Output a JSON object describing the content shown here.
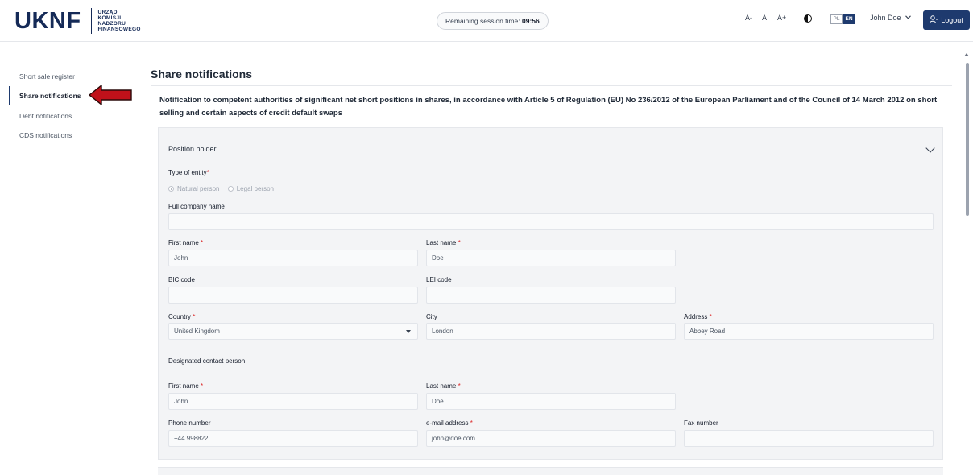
{
  "header": {
    "logo_main": "UKNF",
    "logo_sub": [
      "URZĄD",
      "KOMISJI",
      "NADZORU",
      "FINANSOWEGO"
    ],
    "session_label": "Remaining session time:",
    "session_time": "09:56",
    "font_decrease": "A-",
    "font_normal": "A",
    "font_increase": "A+",
    "lang_pl": "PL",
    "lang_en": "EN",
    "user_name": "John Doe",
    "logout_label": "Logout"
  },
  "sidebar": {
    "items": [
      {
        "label": "Short sale register",
        "active": false
      },
      {
        "label": "Share notifications",
        "active": true
      },
      {
        "label": "Debt notifications",
        "active": false
      },
      {
        "label": "CDS notifications",
        "active": false
      }
    ]
  },
  "main": {
    "title": "Share notifications",
    "description": "Notification to competent authorities of significant net short positions in shares, in accordance with Article 5 of Regulation (EU) No 236/2012 of the European Parliament and of the Council of 14 March 2012 on short selling and certain aspects of credit default swaps",
    "section_title": "Position holder",
    "entity_type_label": "Type of entity",
    "entity_options": [
      "Natural person",
      "Legal person"
    ],
    "full_company_name_label": "Full company name",
    "full_company_name_value": "",
    "first_name_label": "First name",
    "first_name_value": "John",
    "last_name_label": "Last name",
    "last_name_value": "Doe",
    "bic_label": "BIC code",
    "bic_value": "",
    "lei_label": "LEI code",
    "lei_value": "",
    "country_label": "Country",
    "country_value": "United Kingdom",
    "city_label": "City",
    "city_value": "London",
    "address_label": "Address",
    "address_value": "Abbey Road",
    "contact_section": "Designated contact person",
    "contact_first_name_label": "First name",
    "contact_first_name_value": "John",
    "contact_last_name_label": "Last name",
    "contact_last_name_value": "Doe",
    "phone_label": "Phone number",
    "phone_value": "+44 998822",
    "email_label": "e-mail address",
    "email_value": "john@doe.com",
    "fax_label": "Fax number",
    "fax_value": "",
    "required_mark": "*"
  },
  "colors": {
    "brand": "#152a57",
    "accent": "#1e3a6e",
    "required": "#dc2626",
    "arrow": "#c0111a"
  }
}
